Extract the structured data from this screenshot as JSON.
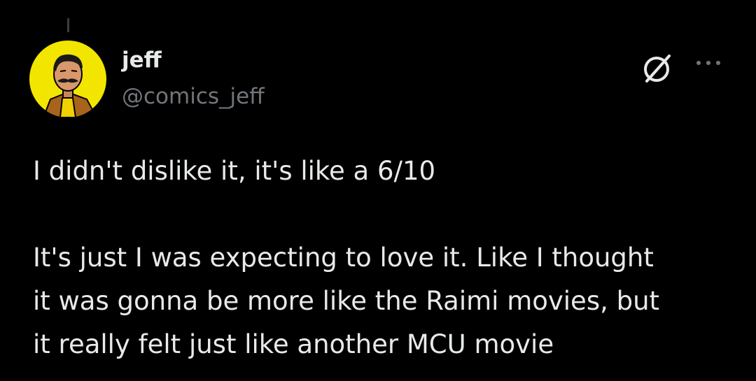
{
  "user": {
    "display_name": "jeff",
    "handle": "@comics_jeff"
  },
  "tweet": {
    "lines": [
      "I didn't dislike it, it's like a 6/10",
      "",
      "It's just I was expecting to love it. Like I thought",
      "it was gonna be more like the Raimi movies, but",
      "it really felt just like another MCU movie"
    ]
  },
  "icons": {
    "avatar": "avatar-image",
    "grok": "grok-icon",
    "more": "more-options-icon"
  },
  "colors": {
    "background": "#000000",
    "text_primary": "#e7e9ea",
    "text_secondary": "#71767b",
    "avatar_bg": "#f2e600"
  }
}
